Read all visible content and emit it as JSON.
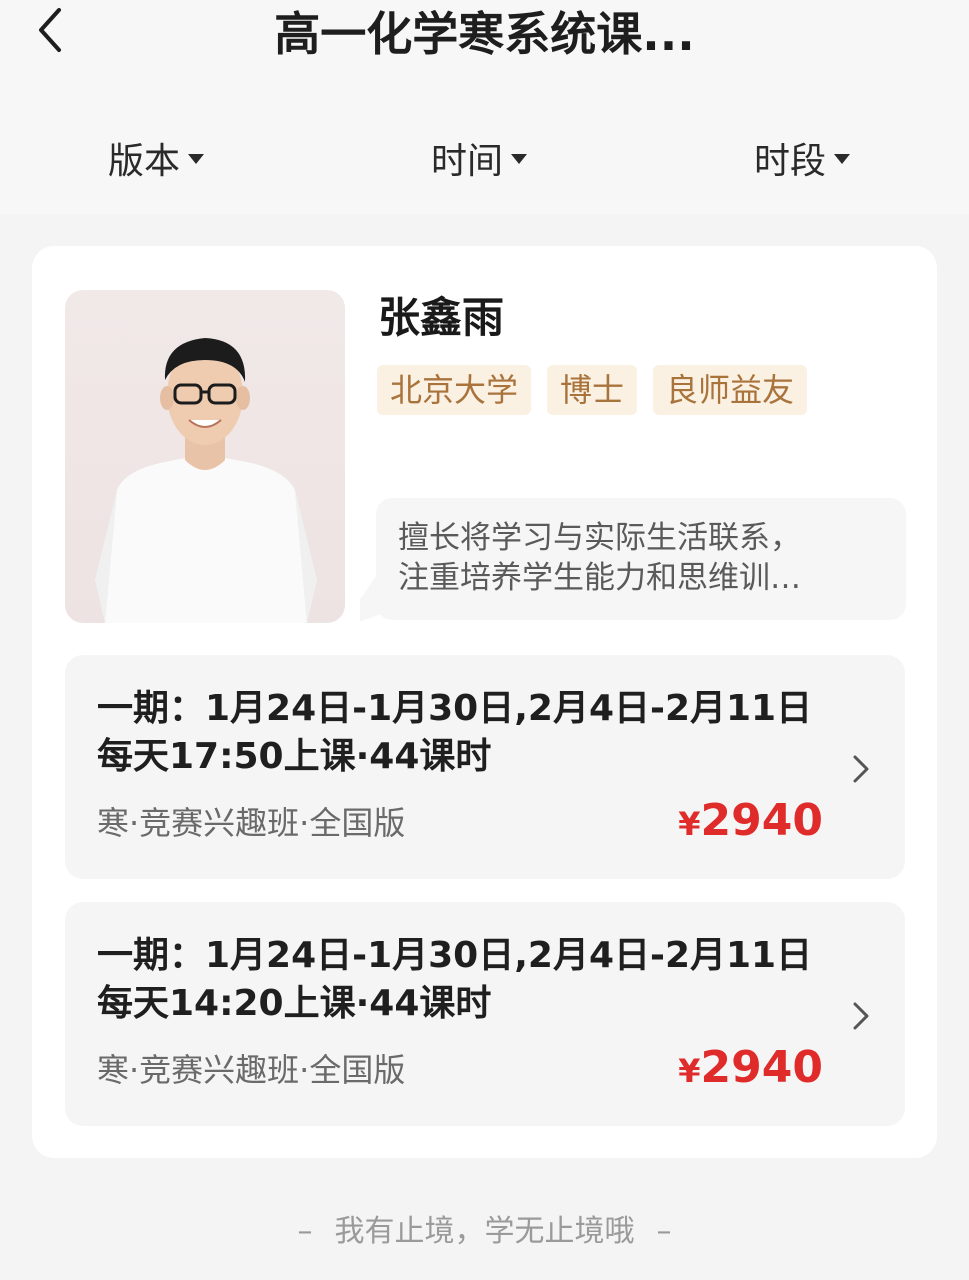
{
  "header": {
    "title": "高一化学寒系统课...",
    "back_icon": "chevron-left-icon"
  },
  "filters": [
    {
      "label": "版本"
    },
    {
      "label": "时间"
    },
    {
      "label": "时段"
    }
  ],
  "teacher": {
    "name": "张鑫雨",
    "tags": [
      "北京大学",
      "博士",
      "良师益友"
    ],
    "bio": "擅长将学习与实际生活联系，\n注重培养学生能力和思维训…"
  },
  "sessions": [
    {
      "schedule": "一期：1月24日-1月30日,2月4日-2月11日每天17:50上课·44课时",
      "meta": "寒·竞赛兴趣班·全国版",
      "currency": "¥",
      "price": "2940"
    },
    {
      "schedule": "一期：1月24日-1月30日,2月4日-2月11日每天14:20上课·44课时",
      "meta": "寒·竞赛兴趣班·全国版",
      "currency": "¥",
      "price": "2940"
    }
  ],
  "footer": {
    "slogan": "我有止境，学无止境哦",
    "dash": "–"
  },
  "colors": {
    "price": "#e02b2b",
    "tag_bg": "#fbf1e3",
    "tag_text": "#a9733c"
  }
}
